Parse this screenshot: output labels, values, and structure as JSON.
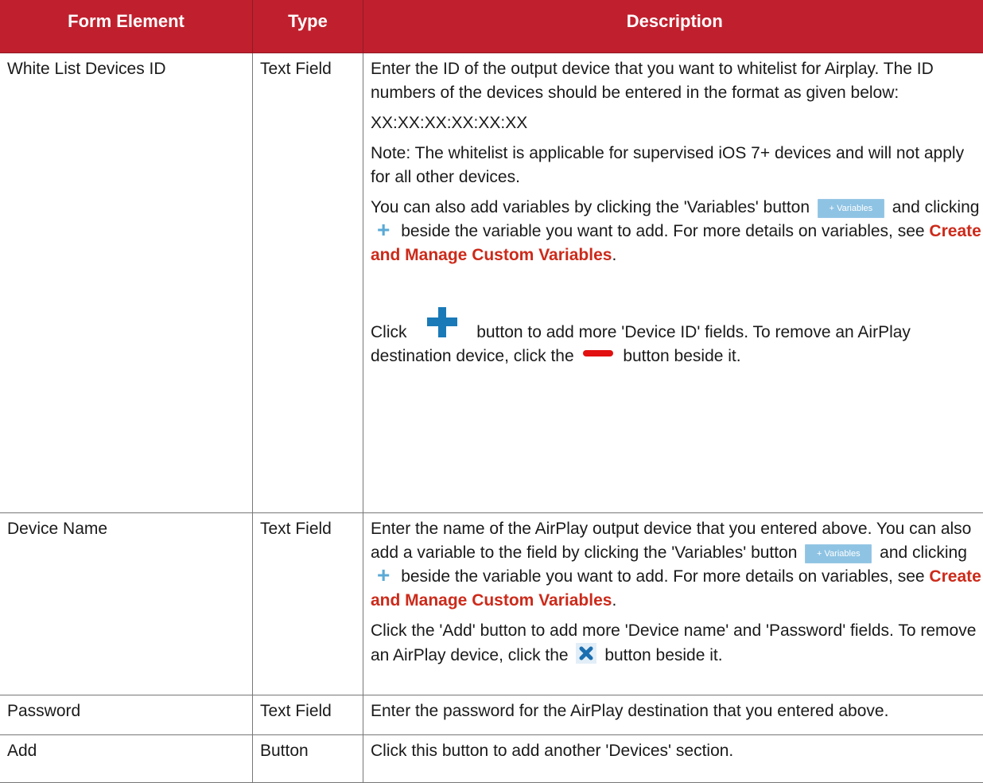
{
  "headers": {
    "col1": "Form Element",
    "col2": "Type",
    "col3": "Description"
  },
  "rows": [
    {
      "element": "White List Devices ID",
      "type": "Text Field",
      "p1": "Enter the ID of the output device that you want to whitelist for Airplay. The ID numbers of the devices should be entered in the format as given below:",
      "p2": "XX:XX:XX:XX:XX:XX",
      "p3": "Note: The whitelist is applicable for supervised iOS 7+ devices and will not apply for all other devices.",
      "p4_before": "You can also add variables by clicking the 'Variables' button",
      "p4_mid1": "and clicking",
      "p4_mid2": "beside the variable you want to add. For more details on variables, see",
      "p4_link": "Create and Manage Custom Variables",
      "p4_end": ".",
      "p5_before": "Click",
      "p5_mid": "button to add more 'Device ID' fields. To remove an AirPlay destination device, click the",
      "p5_end": "button beside it."
    },
    {
      "element": "Device Name",
      "type": "Text Field",
      "p1_before": "Enter the name of the AirPlay output device that you entered above. You can also add a variable to the field by clicking the 'Variables' button",
      "p1_mid1": "and clicking",
      "p1_mid2": "beside the variable you want to add.  For more details on variables, see",
      "p1_link": "Create and Manage Custom Variables",
      "p1_end": ".",
      "p2_before": "Click the 'Add' button to add more 'Device name' and 'Password' fields. To remove an AirPlay device, click the",
      "p2_end": "button beside it."
    },
    {
      "element": "Password",
      "type": "Text Field",
      "desc": "Enter the password for the AirPlay destination that you entered above."
    },
    {
      "element": "Add",
      "type": "Button",
      "desc": "Click this button to add another 'Devices' section."
    }
  ],
  "widgets": {
    "variables_button_label": "+ Variables"
  },
  "icons": {
    "plus_small": "plus-icon",
    "plus_big": "add-plus-icon",
    "minus": "minus-red-icon",
    "close": "close-x-icon"
  },
  "colors": {
    "header_bg": "#c0202e",
    "link": "#cc2a1a",
    "variables_btn": "#8ec3e3",
    "plus_blue": "#1a7ab8",
    "minus_red": "#e21010"
  }
}
